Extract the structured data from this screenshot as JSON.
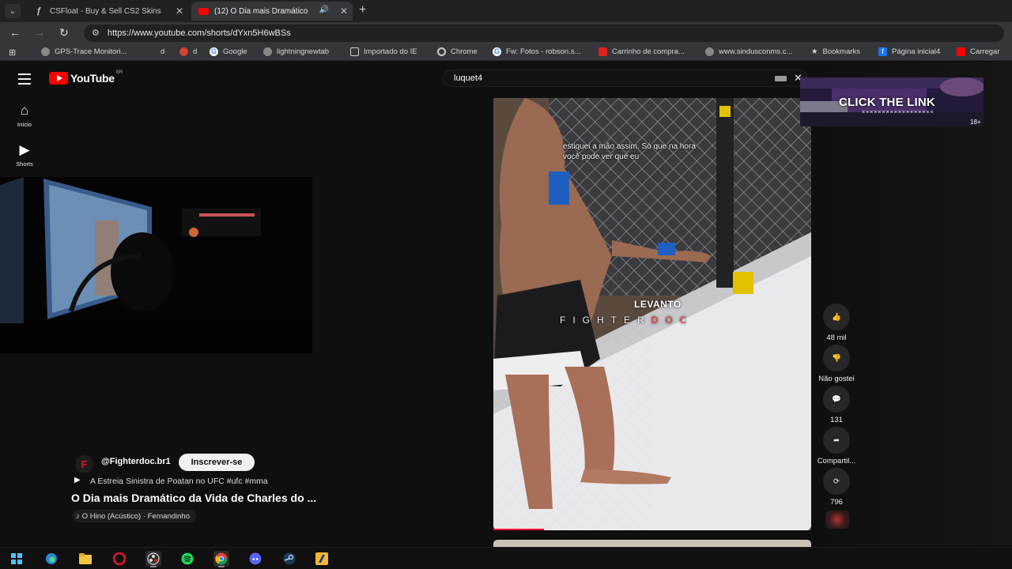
{
  "browser": {
    "tabs": [
      {
        "title": "CSFloat - Buy & Sell CS2 Skins",
        "icon": "csfloat-icon",
        "active": false
      },
      {
        "title": "(12) O Dia mais Dramático",
        "icon": "youtube-icon",
        "active": true
      }
    ],
    "url": "https://www.youtube.com/shorts/dYxn5H6wBSs",
    "bookmarks": [
      {
        "label": "GPS-Trace Monitori...",
        "icon": "globe-icon"
      },
      {
        "label": "d",
        "icon": "blank-icon"
      },
      {
        "label": "d",
        "icon": "music-icon"
      },
      {
        "label": "Google",
        "icon": "google-icon"
      },
      {
        "label": "lightningnewtab",
        "icon": "globe-icon"
      },
      {
        "label": "Importado do IE",
        "icon": "folder-icon"
      },
      {
        "label": "Chrome",
        "icon": "chrome-icon"
      },
      {
        "label": "Fw: Fotos - robson.s...",
        "icon": "google-icon"
      },
      {
        "label": "Carrinho de compra...",
        "icon": "store-icon"
      },
      {
        "label": "www.sindusconms.c...",
        "icon": "globe-icon"
      },
      {
        "label": "Bookmarks",
        "icon": "star-icon"
      },
      {
        "label": "Página inicial4",
        "icon": "facebook-icon"
      },
      {
        "label": "Carregar",
        "icon": "youtube-icon"
      }
    ]
  },
  "youtube": {
    "logo_text": "YouTube",
    "country_code": "BR",
    "guide": [
      {
        "label": "Início",
        "icon": "home-icon"
      },
      {
        "label": "Shorts",
        "icon": "shorts-icon"
      }
    ],
    "search_query": "luquet4"
  },
  "short": {
    "channel": "@Fighterdoc.br1",
    "channel_initial": "F",
    "subscribe_label": "Inscrever-se",
    "playlist": "A Estreia Sinistra de Poatan no UFC #ufc #mma",
    "title": "O Dia mais Dramático da Vida de Charles do ...",
    "music": "O Hino (Acústico) · Fernandinho",
    "caption": "estiquei a mão assim. Só que na hora\nvocê pode ver que eu",
    "watermark_top": "LEVANTO",
    "watermark_main": "FIGHTER",
    "watermark_accent": "DOC",
    "progress": 0.16,
    "actions": [
      {
        "label": "48 mil",
        "icon": "like-icon"
      },
      {
        "label": "Não gostei",
        "icon": "dislike-icon"
      },
      {
        "label": "131",
        "icon": "comment-icon"
      },
      {
        "label": "Compartil...",
        "icon": "share-icon"
      },
      {
        "label": "796",
        "icon": "remix-icon"
      }
    ]
  },
  "ad": {
    "text": "CLICK THE LINK",
    "rating": "18+",
    "decoration": "××××××××××××××××××"
  },
  "taskbar": {
    "icons": [
      "windows-icon",
      "edge-icon",
      "file-explorer-icon",
      "opera-icon",
      "obs-icon",
      "spotify-icon",
      "chrome-icon",
      "discord-icon",
      "steam-icon",
      "app-icon"
    ]
  },
  "colors": {
    "youtube_red": "#ff0000",
    "progress_red": "#ff0033",
    "background": "#0f0f0f"
  }
}
